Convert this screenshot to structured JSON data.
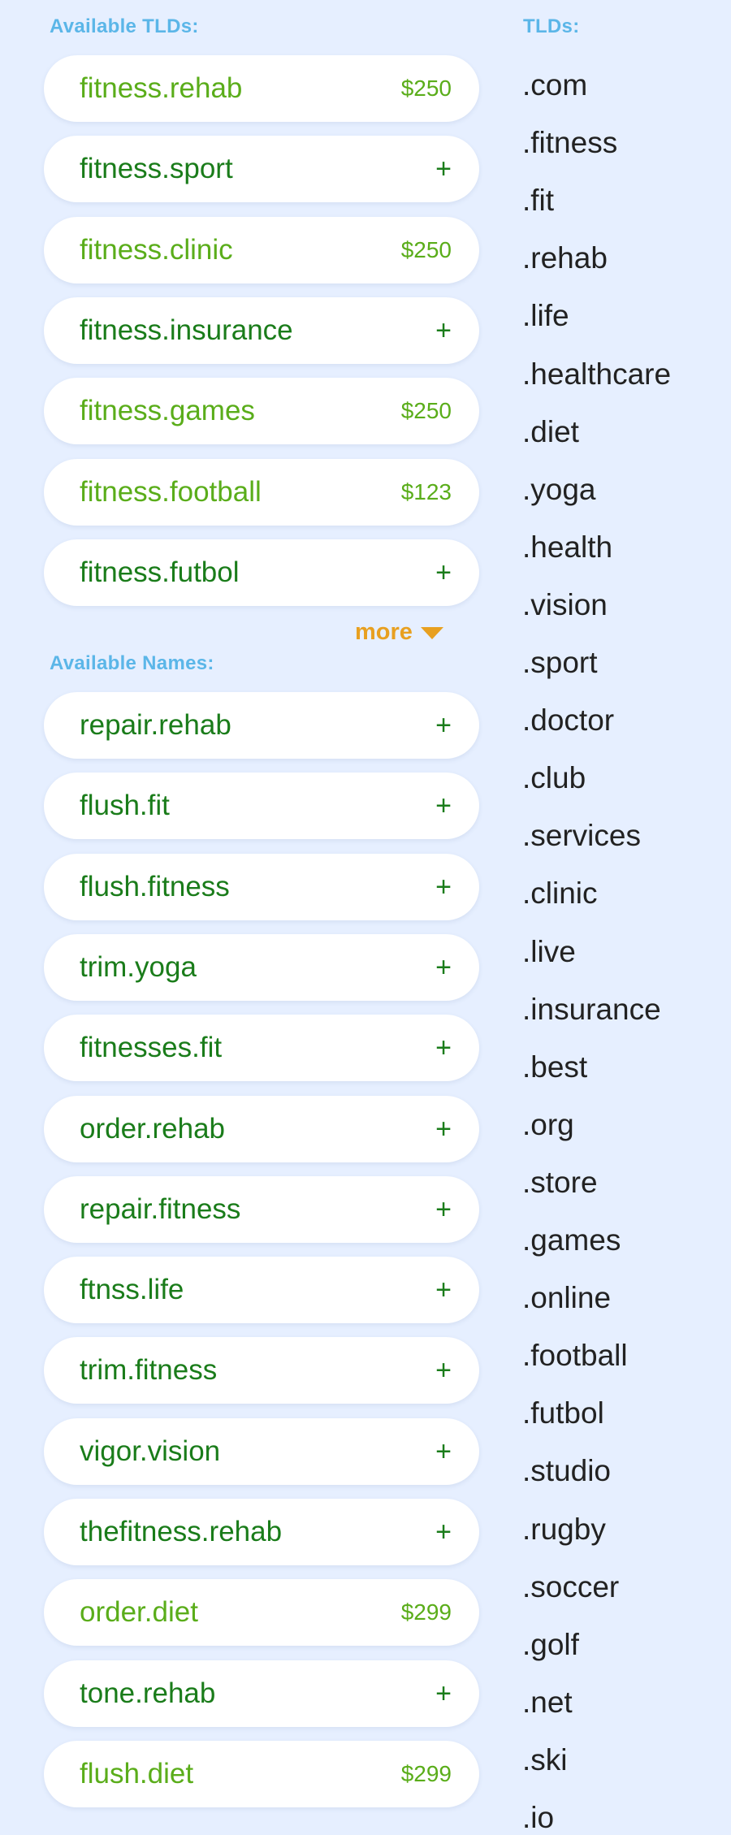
{
  "tlds_section": {
    "label": "Available TLDs:",
    "items": [
      {
        "name": "fitness.rehab",
        "price": "$250"
      },
      {
        "name": "fitness.sport",
        "action": "+"
      },
      {
        "name": "fitness.clinic",
        "price": "$250"
      },
      {
        "name": "fitness.insurance",
        "action": "+"
      },
      {
        "name": "fitness.games",
        "price": "$250"
      },
      {
        "name": "fitness.football",
        "price": "$123"
      },
      {
        "name": "fitness.futbol",
        "action": "+"
      }
    ],
    "more_label": "more"
  },
  "names_section": {
    "label": "Available Names:",
    "items": [
      {
        "name": "repair.rehab",
        "action": "+"
      },
      {
        "name": "flush.fit",
        "action": "+"
      },
      {
        "name": "flush.fitness",
        "action": "+"
      },
      {
        "name": "trim.yoga",
        "action": "+"
      },
      {
        "name": "fitnesses.fit",
        "action": "+"
      },
      {
        "name": "order.rehab",
        "action": "+"
      },
      {
        "name": "repair.fitness",
        "action": "+"
      },
      {
        "name": "ftnss.life",
        "action": "+"
      },
      {
        "name": "trim.fitness",
        "action": "+"
      },
      {
        "name": "vigor.vision",
        "action": "+"
      },
      {
        "name": "thefitness.rehab",
        "action": "+"
      },
      {
        "name": "order.diet",
        "price": "$299"
      },
      {
        "name": "tone.rehab",
        "action": "+"
      },
      {
        "name": "flush.diet",
        "price": "$299"
      }
    ]
  },
  "tld_list": {
    "label": "TLDs:",
    "items": [
      ".com",
      ".fitness",
      ".fit",
      ".rehab",
      ".life",
      ".healthcare",
      ".diet",
      ".yoga",
      ".health",
      ".vision",
      ".sport",
      ".doctor",
      ".club",
      ".services",
      ".clinic",
      ".live",
      ".insurance",
      ".best",
      ".org",
      ".store",
      ".games",
      ".online",
      ".football",
      ".futbol",
      ".studio",
      ".rugby",
      ".soccer",
      ".golf",
      ".net",
      ".ski",
      ".io"
    ]
  },
  "colors": {
    "background": "#e6efff",
    "label_blue": "#5bb6e8",
    "name_green": "#1a7c1a",
    "priced_green": "#5aad1a",
    "more_orange": "#e8a020"
  },
  "icons": {
    "more": "triangle-down-icon",
    "add": "plus-icon"
  }
}
